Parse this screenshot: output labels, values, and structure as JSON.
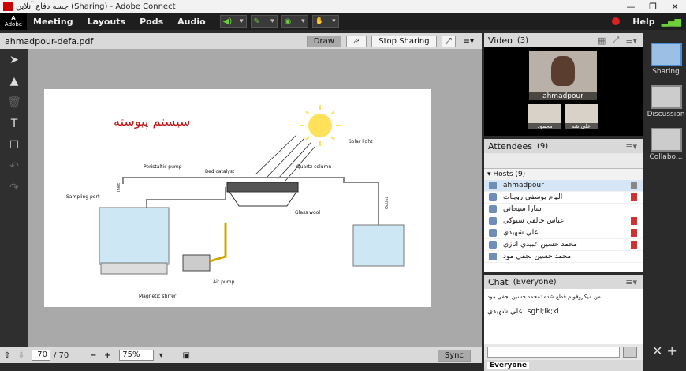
{
  "window": {
    "title": "جسه دفاع آنلاين (Sharing) - Adobe Connect"
  },
  "menubar": {
    "logo": "Adobe",
    "items": [
      "Meeting",
      "Layouts",
      "Pods",
      "Audio"
    ],
    "help": "Help"
  },
  "share": {
    "filename": "ahmadpour-defa.pdf",
    "draw_label": "Draw",
    "stop_label": "Stop Sharing",
    "page_current": "70",
    "page_total": "/ 70",
    "zoom": "75%",
    "sync_label": "Sync"
  },
  "slide": {
    "title": "سيستم پيوسته",
    "labels": {
      "solar": "Solar light",
      "peristaltic": "Peristaltic pump",
      "bed": "Bed catalyst",
      "quartz": "Quartz column",
      "sampling": "Sampling port",
      "glasswool": "Glass wool",
      "airpump": "Air pump",
      "stirrer": "Magnetic stirrer",
      "inlet": "Inlet",
      "outlet": "Outlet"
    }
  },
  "video": {
    "title": "Video",
    "count": "(3)",
    "main_name": "ahmadpour",
    "small1": "محمود",
    "small2": "علی شه"
  },
  "attendees": {
    "title": "Attendees",
    "count": "(9)",
    "hosts_label": "Hosts (9)",
    "rows": [
      "ahmadpour",
      "الهام يوسفي رويبات",
      "سارا سيحاني",
      "عباس خالقي سيوكي",
      "علي شهيدي",
      "محمد حسين عبيدي انازي",
      "محمد حسين نجفي مود"
    ]
  },
  "chat": {
    "title": "Chat",
    "scope": "(Everyone)",
    "msg1": "من ميكروفونم قطع شده :محمد حسين نجفي مود",
    "msg2": "علي شهيدي: sghl;lk;kl",
    "tab": "Everyone"
  },
  "sidebar": {
    "layouts": [
      "Sharing",
      "Discussion",
      "Collabo..."
    ]
  }
}
